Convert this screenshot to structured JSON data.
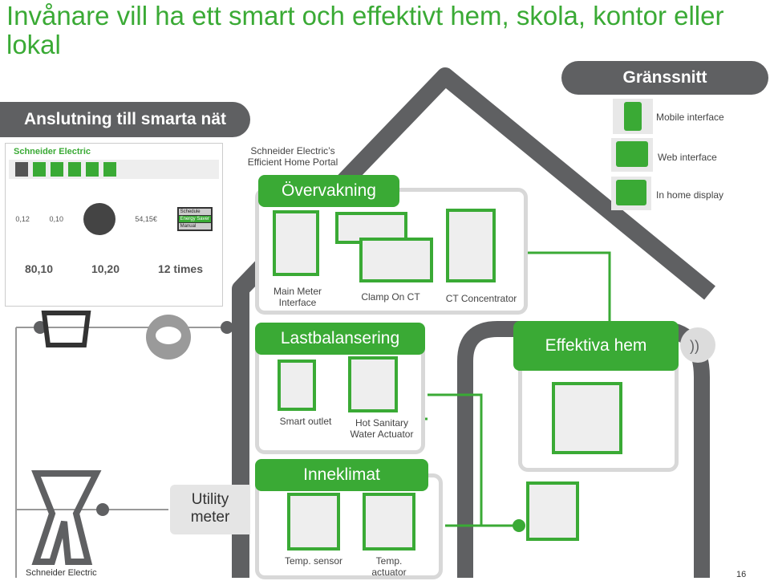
{
  "title": "Invånare vill ha ett smart och effektivt hem, skola, kontor eller lokal",
  "left_header": "Anslutning till smarta nät",
  "interfaces": {
    "header": "Gränssnitt",
    "items": [
      {
        "label": "Mobile interface",
        "icon": "mobile-phone-icon"
      },
      {
        "label": "Web interface",
        "icon": "laptop-icon"
      },
      {
        "label": "In home display",
        "icon": "display-icon"
      }
    ]
  },
  "portal": {
    "caption_line1": "Schneider Electric’s",
    "caption_line2": "Efficient Home Portal",
    "brand": "Schneider Electric",
    "values": {
      "tariff_1": "0,12",
      "tariff_2": "0,10",
      "monthly": "54,15€",
      "menu": [
        "Schedule",
        "Energy Saver",
        "Manual"
      ],
      "savings": [
        "80,10",
        "10,20",
        "12 times"
      ]
    }
  },
  "sections": {
    "overvakning": {
      "label": "Övervakning",
      "devices": [
        "Main Meter Interface",
        "Clamp On CT",
        "CT Concentrator"
      ]
    },
    "lastbalansering": {
      "label": "Lastbalansering",
      "devices": [
        "Smart outlet",
        "Hot Sanitary Water Actuator"
      ]
    },
    "inneklimat": {
      "label": "Inneklimat",
      "devices": [
        "Temp. sensor",
        "Temp. actuator"
      ]
    },
    "effektiva": {
      "label": "Effektiva hem"
    }
  },
  "utility_meter": "Utility meter",
  "footer": {
    "company": "Schneider Electric",
    "page": "16"
  },
  "colors": {
    "green": "#3aaa35",
    "gray": "#5f6062",
    "light": "#d8d8d8"
  }
}
